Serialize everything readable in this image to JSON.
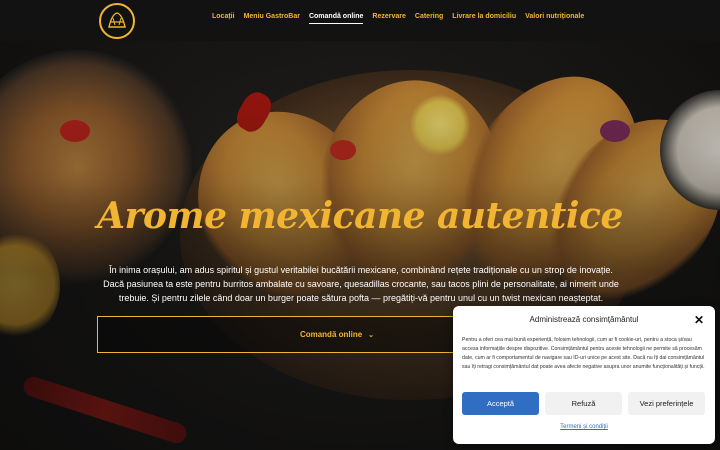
{
  "header": {
    "logo_icon": "restaurant-logo-icon",
    "nav": [
      {
        "label": "Locații"
      },
      {
        "label": "Meniu GastroBar"
      },
      {
        "label": "Comandă online"
      },
      {
        "label": "Rezervare"
      },
      {
        "label": "Catering"
      },
      {
        "label": "Livrare la domiciliu"
      },
      {
        "label": "Valori nutriționale"
      }
    ],
    "active_nav": "Comandă online"
  },
  "hero": {
    "headline": "Arome mexicane autentice",
    "intro": "În inima orașului, am adus spiritul și gustul veritabilei bucătării mexicane, combinând rețete tradiționale cu un strop de inovație. Dacă pasiunea ta este pentru burritos ambalate cu savoare, quesadillas crocante, sau tacos plini de personalitate, ai nimerit unde trebuie. Și pentru zilele când doar un burger poate sătura pofta — pregătiți-vă pentru unul cu un twist mexican neașteptat.",
    "cta_label": "Comandă online",
    "cta_icon": "chevron-down-icon"
  },
  "consent": {
    "title": "Administrează consimțământul",
    "close_icon": "close-icon",
    "body": "Pentru a oferi cea mai bună experiență, folosim tehnologii, cum ar fi cookie-uri, pentru a stoca și/sau accesa informațiile despre dispozitive. Consimțământul pentru aceste tehnologii ne permite să procesăm date, cum ar fi comportamentul de navigare sau ID-uri unice pe acest site. Dacă nu îți dai consimțământul sau îți retragi consimțământul dat poate avea afecte negative asupra unor anumite funcționalități și funcții.",
    "accept_label": "Acceptă",
    "refuse_label": "Refuză",
    "prefs_label": "Vezi preferințele",
    "terms_link": "Termeni și condiții"
  },
  "colors": {
    "accent": "#f2b533",
    "header_bg": "#121212",
    "accept_button": "#2f6ec2"
  }
}
